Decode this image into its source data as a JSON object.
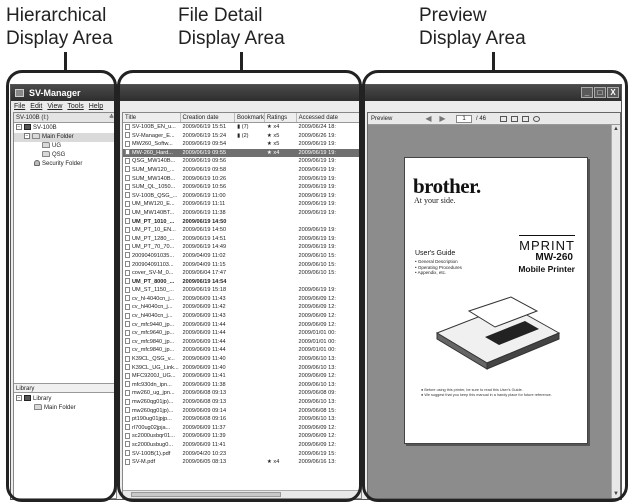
{
  "callouts": {
    "hierarchical": [
      "Hierarchical",
      "Display Area"
    ],
    "file_detail": [
      "File Detail",
      "Display Area"
    ],
    "preview": [
      "Preview",
      "Display Area"
    ]
  },
  "window": {
    "title": "SV-Manager",
    "controls": [
      "_",
      "□",
      "X"
    ]
  },
  "menu": [
    "File",
    "Edit",
    "View",
    "Tools",
    "Help"
  ],
  "tree": {
    "drive": "SV-100B (I:)",
    "nodes": [
      {
        "label": "SV-100B",
        "toggle": "−"
      },
      {
        "label": "Main Folder",
        "toggle": "−"
      },
      {
        "label": "UG",
        "toggle": ""
      },
      {
        "label": "QSG",
        "toggle": ""
      },
      {
        "label": "Security Folder",
        "toggle": ""
      }
    ]
  },
  "library": {
    "header": "Library",
    "nodes": [
      {
        "label": "Library",
        "toggle": "−"
      },
      {
        "label": "Main Folder",
        "toggle": ""
      }
    ]
  },
  "table": {
    "columns": [
      "Title",
      "Creation date",
      "Bookmark",
      "Ratings",
      "Accessed date"
    ],
    "rows": [
      [
        "SV-100B_EN_u...",
        "2009/06/19 15:51",
        "(7)",
        "x4",
        "2009/06/24 18:"
      ],
      [
        "SV-Manager_E...",
        "2009/06/19 15:24",
        "(2)",
        "x5",
        "2009/06/26 19:"
      ],
      [
        "MW260_Softw...",
        "2009/06/19 09:54",
        "",
        "x5",
        "2009/06/19 19:"
      ],
      [
        "MW-260_Hard...",
        "2009/06/19 09:55",
        "",
        "x4",
        "2009/06/19 19:"
      ],
      [
        "QSG_MW140B...",
        "2009/06/19 09:56",
        "",
        "",
        "2009/06/19 19:"
      ],
      [
        "SUM_MW120_...",
        "2009/06/19 09:58",
        "",
        "",
        "2009/06/19 19:"
      ],
      [
        "SUM_MW140B...",
        "2009/06/19 10:26",
        "",
        "",
        "2009/06/19 19:"
      ],
      [
        "SUM_QL_1050...",
        "2009/06/19 10:56",
        "",
        "",
        "2009/06/19 19:"
      ],
      [
        "SV-100B_QSG_...",
        "2009/06/19 11:00",
        "",
        "",
        "2009/06/19 19:"
      ],
      [
        "UM_MW120_E...",
        "2009/06/19 11:11",
        "",
        "",
        "2009/06/19 19:"
      ],
      [
        "UM_MW140BT...",
        "2009/06/19 11:38",
        "",
        "",
        "2009/06/19 19:"
      ],
      [
        "UM_PT_1010_...",
        "2009/06/19 14:50",
        "",
        "",
        ""
      ],
      [
        "UM_PT_10_EN...",
        "2009/06/19 14:50",
        "",
        "",
        "2009/06/19 19:"
      ],
      [
        "UM_PT_1280_...",
        "2009/06/19 14:51",
        "",
        "",
        "2009/06/19 19:"
      ],
      [
        "UM_PT_70_70...",
        "2009/06/19 14:49",
        "",
        "",
        "2009/06/19 19:"
      ],
      [
        "200904091035...",
        "2009/04/09 11:02",
        "",
        "",
        "2009/06/10 15:"
      ],
      [
        "200904091103...",
        "2009/04/09 11:15",
        "",
        "",
        "2009/06/10 15:"
      ],
      [
        "cover_SV-M_0...",
        "2009/06/04 17:47",
        "",
        "",
        "2009/06/10 15:"
      ],
      [
        "UM_PT_8000_...",
        "2009/06/19 14:54",
        "",
        "",
        ""
      ],
      [
        "UM_ST_1150_...",
        "2009/06/19 15:18",
        "",
        "",
        "2009/06/19 19:"
      ],
      [
        "cv_hl-4040cn_j...",
        "2009/06/09 11:43",
        "",
        "",
        "2009/06/09 12:"
      ],
      [
        "cv_hl4040cn_j...",
        "2009/06/09 11:42",
        "",
        "",
        "2009/06/09 12:"
      ],
      [
        "cv_hl4040cn_j...",
        "2009/06/09 11:43",
        "",
        "",
        "2009/06/09 12:"
      ],
      [
        "cv_mfc9440_jp...",
        "2009/06/09 11:44",
        "",
        "",
        "2009/06/09 12:"
      ],
      [
        "cv_mfc9640_jp...",
        "2009/06/09 11:44",
        "",
        "",
        "2009/01/01 00:"
      ],
      [
        "cv_mfc9840_jp...",
        "2009/06/09 11:44",
        "",
        "",
        "2009/01/01 00:"
      ],
      [
        "cv_mfc9840_jp...",
        "2009/06/09 11:44",
        "",
        "",
        "2009/01/01 00:"
      ],
      [
        "K39CL_QSG_v...",
        "2009/06/09 11:40",
        "",
        "",
        "2009/06/10 13:"
      ],
      [
        "K39CL_UG_Link...",
        "2009/06/09 11:40",
        "",
        "",
        "2009/06/10 13:"
      ],
      [
        "MFC9200J_UG...",
        "2009/06/09 11:41",
        "",
        "",
        "2009/06/09 12:"
      ],
      [
        "mfc930dn_ipn...",
        "2009/06/09 11:38",
        "",
        "",
        "2009/06/10 13:"
      ],
      [
        "mw260_ug_jpn...",
        "2009/06/08 09:13",
        "",
        "",
        "2009/06/08 09:"
      ],
      [
        "mw260qg01jp)...",
        "2009/06/08 09:13",
        "",
        "",
        "2009/06/10 13:"
      ],
      [
        "mw260qg01jp)...",
        "2009/06/09 09:14",
        "",
        "",
        "2009/06/08 15:"
      ],
      [
        "pt190ug01jpjp...",
        "2009/06/08 09:16",
        "",
        "",
        "2009/06/10 13:"
      ],
      [
        "rl700ug02jpja...",
        "2009/06/09 11:37",
        "",
        "",
        "2009/06/09 12:"
      ],
      [
        "sc2000usbqr01...",
        "2009/06/09 11:39",
        "",
        "",
        "2009/06/09 12:"
      ],
      [
        "sc2000usbug0...",
        "2009/06/09 11:41",
        "",
        "",
        "2009/06/09 12:"
      ],
      [
        "SV-100B(1).pdf",
        "2009/04/20 10:23",
        "",
        "",
        "2009/06/19 15:"
      ],
      [
        "SV-M.pdf",
        "2009/06/05 08:13",
        "",
        "x4",
        "2009/06/16 13:"
      ]
    ]
  },
  "preview": {
    "label": "Preview",
    "page_number": "1",
    "page_total": "/ 46",
    "document": {
      "brand": "brother.",
      "tagline": "At your side.",
      "guide_title": "User's Guide",
      "guide_items": [
        "• General Description",
        "• Operating Procedures",
        "• Appendix, etc."
      ],
      "logo": "MPRINT",
      "model": "MW-260",
      "subtitle": "Mobile Printer",
      "notes": [
        "● Before using this printer, be sure to read this User's Guide.",
        "● We suggest that you keep this manual in a handy place for future reference."
      ]
    }
  },
  "colors": {
    "titlebar": "#2e2e2e",
    "selected_row": "#6f6f6f",
    "preview_background": "#8c8c8c"
  },
  "icons": [
    "app-icon",
    "drive-icon",
    "folder-icon",
    "lock-icon",
    "library-icon",
    "file-icon",
    "star-icon",
    "bookmark-icon",
    "back-arrow-icon",
    "forward-arrow-icon",
    "zoom-icon"
  ]
}
